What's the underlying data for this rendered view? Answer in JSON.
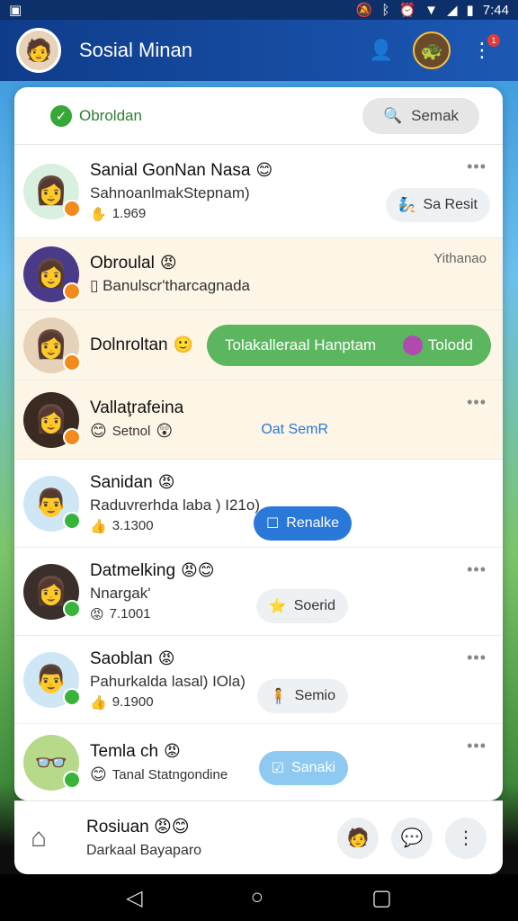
{
  "status_bar": {
    "left_icon": "app-notification-icon",
    "time": "7:44",
    "icons": [
      "mute-icon",
      "bluetooth-icon",
      "alarm-icon",
      "wifi-icon",
      "signal-icon",
      "battery-icon"
    ]
  },
  "header": {
    "title": "Sosial Minan",
    "profile_icon": "profile-icon",
    "game_icon": "game-icon",
    "menu_icon": "menu-icon",
    "badge": "1"
  },
  "tabs": {
    "chats_label": "Obroldan",
    "search_label": "Semak"
  },
  "chats": [
    {
      "name": "Sanial GonNan Nasa",
      "subtitle": "SahnoanlmakStepnam)",
      "meta": "1.969",
      "action_label": "Sa Resit",
      "status": "away",
      "name_emoji": "😊",
      "meta_icon": "hand-icon",
      "action_icon": "sparkle-icon"
    },
    {
      "name": "Obroulal",
      "subtitle": "Banulscr'tharcagnada",
      "time": "Yithanao",
      "status": "away",
      "name_emoji": "😡",
      "sub_icon": "phone-icon"
    },
    {
      "name": "Dolnroltan",
      "action_label": "Tolakalleraal Hanptam",
      "action_tag": "Tolodd",
      "status": "away",
      "name_emoji": "🙂"
    },
    {
      "name": "Vallaţrafeina",
      "meta": "Setnol",
      "action_label": "Oat SemR",
      "status": "away",
      "meta_emoji": "😊"
    },
    {
      "name": "Sanidan",
      "subtitle": "Raduvrerhda laba ) I21o)",
      "meta": "3.1300",
      "action_label": "Renalke",
      "status": "online",
      "name_emoji": "😡"
    },
    {
      "name": "Datmelking",
      "subtitle": "Nnargak'",
      "meta": "7.1001",
      "action_label": "Soerid",
      "status": "online",
      "name_emoji": "😡😊"
    },
    {
      "name": "Saoblan",
      "subtitle": "Pahurkalda lasal) IOla)",
      "meta": "9.1900",
      "action_label": "Semio",
      "status": "online",
      "name_emoji": "😡"
    },
    {
      "name": "Temla ch",
      "subtitle": "Tanal Statngondine",
      "action_label": "Sanaki",
      "status": "online",
      "name_emoji": "😡"
    }
  ],
  "bottom_bar": {
    "name": "Rosiuan",
    "subtitle": "Darkaal Bayaparo"
  },
  "colors": {
    "accent_green": "#5cb65f",
    "accent_blue": "#2a78d8",
    "header_blue": "#1c58b4",
    "online": "#38b43b",
    "away": "#f28a1c"
  }
}
